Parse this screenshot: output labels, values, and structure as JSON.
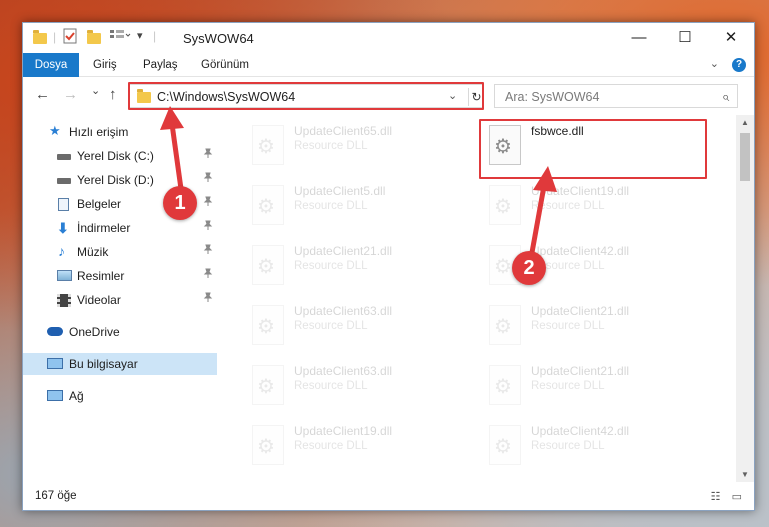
{
  "window": {
    "title": "SysWOW64",
    "minimize": "—",
    "maximize": "☐",
    "close": "✕"
  },
  "ribbon": {
    "tabs": [
      "Dosya",
      "Giriş",
      "Paylaş",
      "Görünüm"
    ],
    "collapse": "⌄",
    "help": "?"
  },
  "nav": {
    "back": "←",
    "forward": "→",
    "recent": "⌄",
    "up": "↑",
    "address": "C:\\Windows\\SysWOW64",
    "address_dropdown": "⌄",
    "refresh": "↻",
    "search_placeholder": "Ara: SysWOW64",
    "search_glyph": "⌕"
  },
  "sidebar": {
    "items": [
      {
        "label": "Hızlı erişim",
        "icon": "star-icon",
        "pinned": false
      },
      {
        "label": "Yerel Disk (C:)",
        "icon": "drive-icon",
        "pinned": true
      },
      {
        "label": "Yerel Disk (D:)",
        "icon": "drive-icon",
        "pinned": true
      },
      {
        "label": "Belgeler",
        "icon": "documents-icon",
        "pinned": true
      },
      {
        "label": "İndirmeler",
        "icon": "download-icon",
        "pinned": true
      },
      {
        "label": "Müzik",
        "icon": "music-icon",
        "pinned": true
      },
      {
        "label": "Resimler",
        "icon": "pictures-icon",
        "pinned": true
      },
      {
        "label": "Videolar",
        "icon": "videos-icon",
        "pinned": true
      },
      {
        "label": "OneDrive",
        "icon": "cloud-icon",
        "pinned": false
      },
      {
        "label": "Bu bilgisayar",
        "icon": "computer-icon",
        "pinned": false,
        "selected": true
      },
      {
        "label": "Ağ",
        "icon": "network-icon",
        "pinned": false
      }
    ],
    "pin_glyph": "📌"
  },
  "files": {
    "left_column": [
      {
        "name": "UpdateClient65.dll",
        "type": "Resource DLL"
      },
      {
        "name": "UpdateClient5.dll",
        "type": "Resource DLL"
      },
      {
        "name": "UpdateClient21.dll",
        "type": "Resource DLL"
      },
      {
        "name": "UpdateClient63.dll",
        "type": "Resource DLL"
      },
      {
        "name": "UpdateClient63.dll",
        "type": "Resource DLL"
      },
      {
        "name": "UpdateClient19.dll",
        "type": "Resource DLL"
      }
    ],
    "right_column": [
      {
        "name": "fsbwce.dll",
        "type": "",
        "highlight": true
      },
      {
        "name": "UpdateClient19.dll",
        "type": "Resource DLL"
      },
      {
        "name": "UpdateClient42.dll",
        "type": "Resource DLL"
      },
      {
        "name": "UpdateClient21.dll",
        "type": "Resource DLL"
      },
      {
        "name": "UpdateClient21.dll",
        "type": "Resource DLL"
      },
      {
        "name": "UpdateClient42.dll",
        "type": "Resource DLL"
      }
    ],
    "gear_glyph": "⚙"
  },
  "status": {
    "count": "167 öğe",
    "details_view": "☷",
    "tiles_view": "▭"
  },
  "annotations": {
    "marker1": "1",
    "marker2": "2",
    "color": "#e0393b"
  },
  "colors": {
    "accent": "#1979ca",
    "selection": "#cce4f7",
    "folder": "#f3c84b"
  }
}
